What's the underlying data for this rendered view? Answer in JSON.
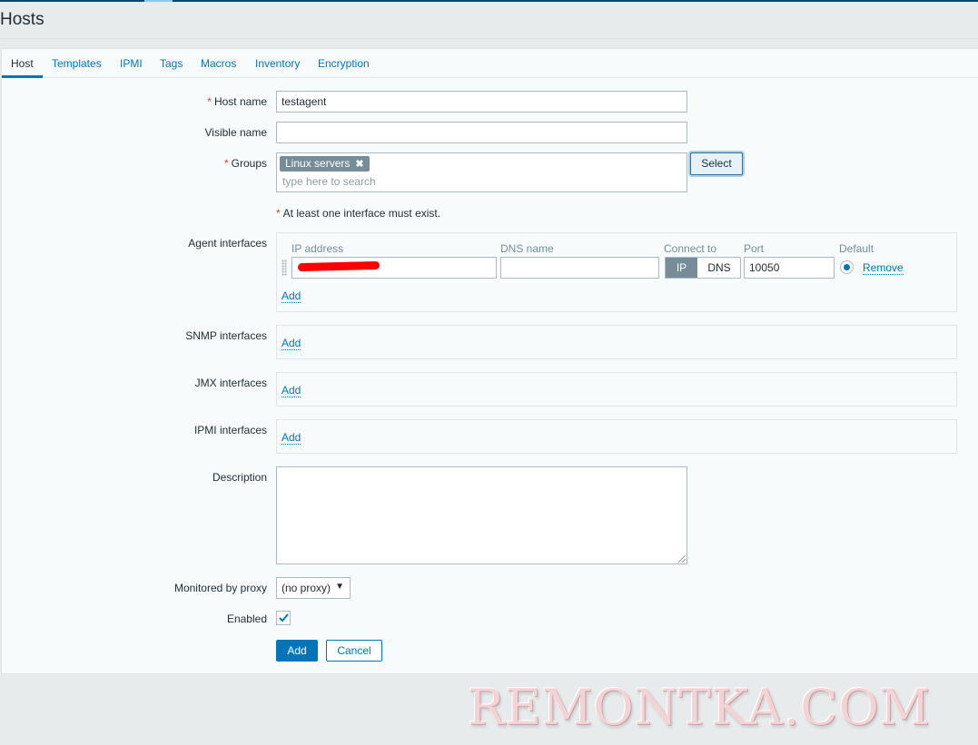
{
  "page": {
    "title": "Hosts"
  },
  "tabs": [
    {
      "label": "Host",
      "active": true
    },
    {
      "label": "Templates",
      "active": false
    },
    {
      "label": "IPMI",
      "active": false
    },
    {
      "label": "Tags",
      "active": false
    },
    {
      "label": "Macros",
      "active": false
    },
    {
      "label": "Inventory",
      "active": false
    },
    {
      "label": "Encryption",
      "active": false
    }
  ],
  "form": {
    "required_mark": "*",
    "host_name": {
      "label": "Host name",
      "value": "testagent"
    },
    "visible_name": {
      "label": "Visible name",
      "value": ""
    },
    "groups": {
      "label": "Groups",
      "selected": [
        "Linux servers"
      ],
      "remove_glyph": "✖",
      "placeholder": "type here to search",
      "select_button": "Select"
    },
    "interface_note": "At least one interface must exist.",
    "agent_interfaces": {
      "label": "Agent interfaces",
      "columns": {
        "ip": "IP address",
        "dns": "DNS name",
        "connect_to": "Connect to",
        "port": "Port",
        "default": "Default"
      },
      "rows": [
        {
          "ip": "(redacted)",
          "dns": "",
          "connect_ip": "IP",
          "connect_dns": "DNS",
          "connect_selected": "IP",
          "port": "10050",
          "default": true,
          "remove_label": "Remove"
        }
      ],
      "add_label": "Add"
    },
    "snmp_interfaces": {
      "label": "SNMP interfaces",
      "add_label": "Add"
    },
    "jmx_interfaces": {
      "label": "JMX interfaces",
      "add_label": "Add"
    },
    "ipmi_interfaces": {
      "label": "IPMI interfaces",
      "add_label": "Add"
    },
    "description": {
      "label": "Description",
      "value": ""
    },
    "monitored_by_proxy": {
      "label": "Monitored by proxy",
      "selected": "(no proxy)",
      "arrow": "▼"
    },
    "enabled": {
      "label": "Enabled",
      "checked": true
    },
    "buttons": {
      "add": "Add",
      "cancel": "Cancel"
    }
  },
  "watermark": "REMONTKA.COM",
  "colors": {
    "accent": "#0275b8",
    "required": "#e33734",
    "chip": "#768d99",
    "topbar": "#0a466a"
  }
}
